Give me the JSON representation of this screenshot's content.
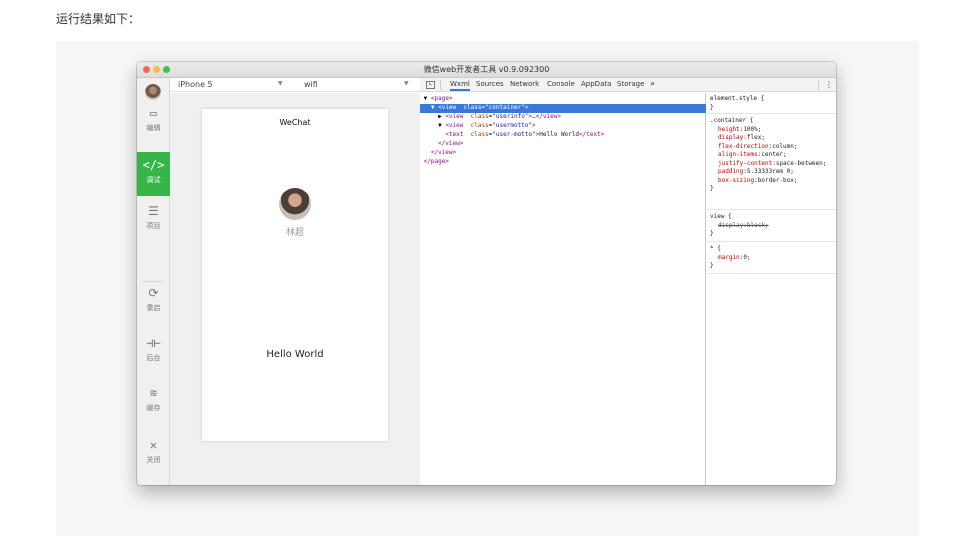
{
  "caption": "运行结果如下：",
  "window": {
    "title": "微信web开发者工具 v0.9.092300"
  },
  "sidebar": {
    "items": [
      {
        "label": "编辑",
        "icon": "code-editor-icon",
        "glyph": "▭"
      },
      {
        "label": "调试",
        "icon": "debug-icon",
        "glyph": "</>"
      },
      {
        "label": "项目",
        "icon": "project-icon",
        "glyph": "☰"
      },
      {
        "label": "重启",
        "icon": "restart-icon",
        "glyph": "⟳"
      },
      {
        "label": "后台",
        "icon": "background-icon",
        "glyph": "⊣⊢"
      },
      {
        "label": "缓存",
        "icon": "cache-icon",
        "glyph": "≋"
      },
      {
        "label": "关闭",
        "icon": "close-icon",
        "glyph": "✕"
      }
    ]
  },
  "device_bar": {
    "device": "iPhone 5",
    "network": "wifi"
  },
  "phone": {
    "title": "WeChat",
    "nickname": "林超",
    "motto": "Hello World"
  },
  "devtools": {
    "tabs": [
      "Wxml",
      "Sources",
      "Network",
      "Console",
      "AppData",
      "Storage"
    ],
    "more": "»",
    "menu": "⋮"
  },
  "wxml_lines": [
    {
      "indent": 1,
      "arrow": "▼",
      "tag_open": "<page>"
    },
    {
      "indent": 2,
      "arrow": "▼",
      "tag_open": "<view",
      "attr": "class",
      "val": "\"container\"",
      "tag_close": ">"
    },
    {
      "indent": 3,
      "arrow": "▶",
      "tag_open": "<view",
      "attr": "class",
      "val": "\"userinfo\"",
      "tag_close": ">…</view>"
    },
    {
      "indent": 3,
      "arrow": "▼",
      "tag_open": "<view",
      "attr": "class",
      "val": "\"usermotto\"",
      "tag_close": ">"
    },
    {
      "indent": 4,
      "arrow": "",
      "tag_open": "<text",
      "attr": "class",
      "val": "\"user-motto\"",
      "tag_close": ">",
      "text": "Hello World",
      "end": "</text>"
    },
    {
      "indent": 3,
      "arrow": "",
      "tag_open": "</view>"
    },
    {
      "indent": 2,
      "arrow": "",
      "tag_open": "</view>"
    },
    {
      "indent": 1,
      "arrow": "",
      "tag_open": "</page>"
    }
  ],
  "styles": {
    "element_style": {
      "selector": "element.style {",
      "close": "}"
    },
    "container_rule": {
      "selector": ".container {",
      "props": [
        {
          "name": "height",
          "value": "100%;"
        },
        {
          "name": "display",
          "value": "flex;"
        },
        {
          "name": "flex-direction",
          "value": "column;"
        },
        {
          "name": "align-items",
          "value": "center;"
        },
        {
          "name": "justify-content",
          "value": "space-between;"
        },
        {
          "name": "padding",
          "value": "5.33333rem 0;"
        },
        {
          "name": "box-sizing",
          "value": "border-box;"
        }
      ],
      "close": "}"
    },
    "view_rule": {
      "selector": "view {",
      "prop": "display:block;",
      "close": "}"
    },
    "star_rule": {
      "selector": "* {",
      "prop_name": "margin",
      "prop_value": "0;",
      "close": "}"
    }
  }
}
